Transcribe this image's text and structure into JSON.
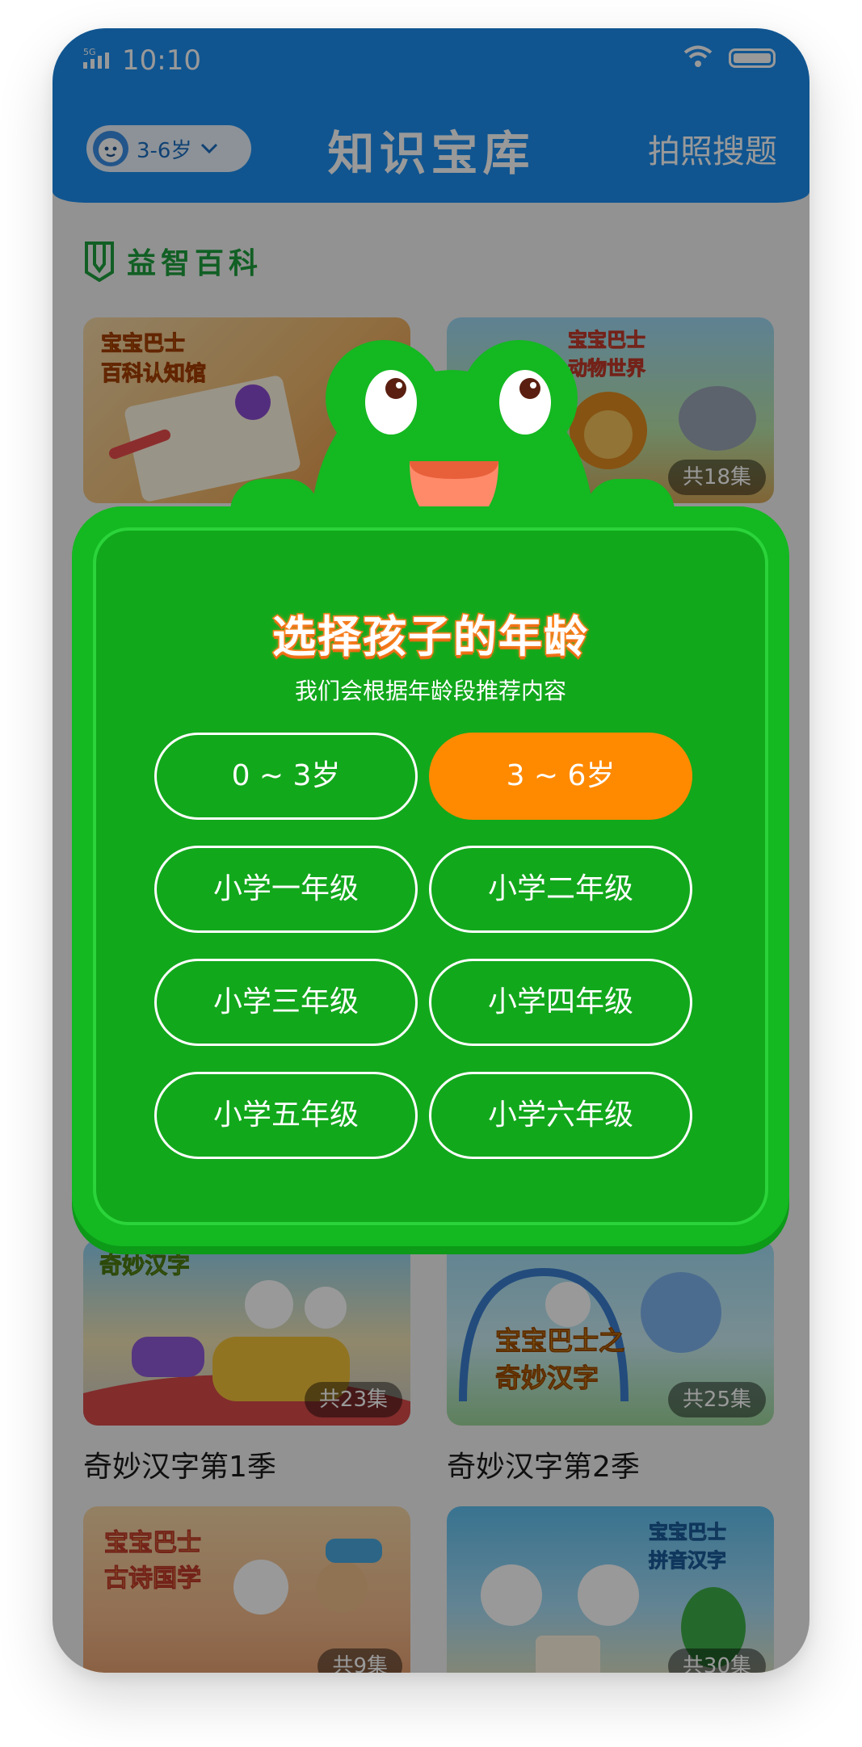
{
  "status_bar": {
    "network": "5G",
    "time": "10:10"
  },
  "header": {
    "age_selector_label": "3-6岁",
    "title": "知识宝库",
    "photo_search_label": "拍照搜题"
  },
  "section": {
    "title": "益智百科"
  },
  "cards": [
    {
      "art_title": "宝宝巴士\n百科认知馆",
      "episodes": "",
      "title": ""
    },
    {
      "art_title": "宝宝巴士\n动物世界",
      "episodes": "共18集",
      "title": ""
    },
    {
      "art_title": "奇妙汉字",
      "episodes": "共23集",
      "title": "奇妙汉字第1季"
    },
    {
      "art_title": "宝宝巴士之\n奇妙汉字",
      "episodes": "共25集",
      "title": "奇妙汉字第2季"
    },
    {
      "art_title": "宝宝巴士\n古诗国学",
      "episodes": "共9集",
      "title": ""
    },
    {
      "art_title": "宝宝巴士\n拼音汉字",
      "episodes": "共30集",
      "title": ""
    }
  ],
  "modal": {
    "title": "选择孩子的年龄",
    "subtitle": "我们会根据年龄段推荐内容",
    "options": [
      {
        "label": "0 ~ 3岁",
        "selected": false
      },
      {
        "label": "3 ~ 6岁",
        "selected": true
      },
      {
        "label": "小学一年级",
        "selected": false
      },
      {
        "label": "小学二年级",
        "selected": false
      },
      {
        "label": "小学三年级",
        "selected": false
      },
      {
        "label": "小学四年级",
        "selected": false
      },
      {
        "label": "小学五年级",
        "selected": false
      },
      {
        "label": "小学六年级",
        "selected": false
      }
    ]
  },
  "colors": {
    "header_blue": "#1c8ef0",
    "modal_green": "#14b821",
    "selected_orange": "#ff8a00",
    "section_green": "#1d9e3d"
  }
}
